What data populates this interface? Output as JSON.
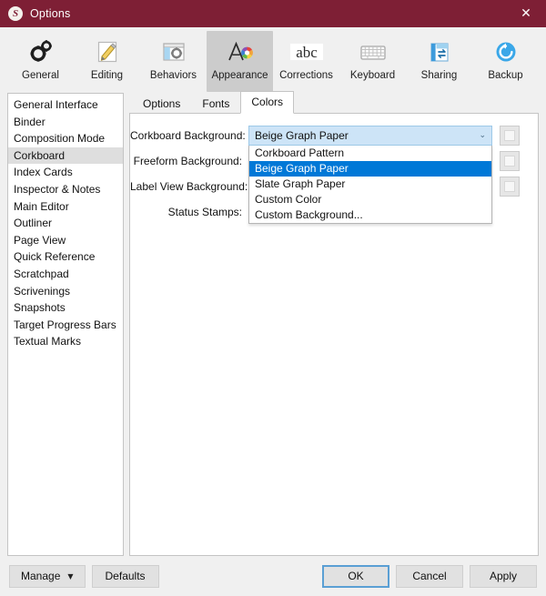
{
  "window": {
    "title": "Options",
    "logo_letter": "S",
    "close_label": "✕"
  },
  "toolbar": {
    "items": [
      {
        "label": "General",
        "icon": "gears-icon",
        "selected": false
      },
      {
        "label": "Editing",
        "icon": "pencil-page-icon",
        "selected": false
      },
      {
        "label": "Behaviors",
        "icon": "window-gear-icon",
        "selected": false
      },
      {
        "label": "Appearance",
        "icon": "a-colorwheel-icon",
        "selected": true
      },
      {
        "label": "Corrections",
        "icon": "abc-icon",
        "selected": false
      },
      {
        "label": "Keyboard",
        "icon": "keyboard-icon",
        "selected": false
      },
      {
        "label": "Sharing",
        "icon": "sharing-icon",
        "selected": false
      },
      {
        "label": "Backup",
        "icon": "backup-circle-icon",
        "selected": false
      }
    ]
  },
  "sidebar": {
    "items": [
      {
        "label": "General Interface",
        "selected": false
      },
      {
        "label": "Binder",
        "selected": false
      },
      {
        "label": "Composition Mode",
        "selected": false
      },
      {
        "label": "Corkboard",
        "selected": true
      },
      {
        "label": "Index Cards",
        "selected": false
      },
      {
        "label": "Inspector & Notes",
        "selected": false
      },
      {
        "label": "Main Editor",
        "selected": false
      },
      {
        "label": "Outliner",
        "selected": false
      },
      {
        "label": "Page View",
        "selected": false
      },
      {
        "label": "Quick Reference",
        "selected": false
      },
      {
        "label": "Scratchpad",
        "selected": false
      },
      {
        "label": "Scrivenings",
        "selected": false
      },
      {
        "label": "Snapshots",
        "selected": false
      },
      {
        "label": "Target Progress Bars",
        "selected": false
      },
      {
        "label": "Textual Marks",
        "selected": false
      }
    ]
  },
  "tabs": [
    {
      "label": "Options",
      "active": false
    },
    {
      "label": "Fonts",
      "active": false
    },
    {
      "label": "Colors",
      "active": true
    }
  ],
  "form": {
    "rows": [
      {
        "label": "Corkboard Background:",
        "control": "combobox"
      },
      {
        "label": "Freeform Background:",
        "control": "swatch"
      },
      {
        "label": "Label View Background:",
        "control": "swatch"
      },
      {
        "label": "Status Stamps:",
        "control": "swatch"
      }
    ]
  },
  "combobox": {
    "value": "Beige Graph Paper",
    "open": true,
    "arrow_glyph": "⌄",
    "options": [
      {
        "label": "Corkboard Pattern",
        "selected": false
      },
      {
        "label": "Beige Graph Paper",
        "selected": true
      },
      {
        "label": "Slate Graph Paper",
        "selected": false
      },
      {
        "label": "Custom Color",
        "selected": false
      },
      {
        "label": "Custom Background...",
        "selected": false
      }
    ]
  },
  "footer": {
    "manage": "Manage",
    "manage_caret": "▼",
    "defaults": "Defaults",
    "ok": "OK",
    "cancel": "Cancel",
    "apply": "Apply"
  },
  "colors": {
    "titlebar": "#7e1f35",
    "selection_blue": "#0078d7",
    "combo_hover": "#cde4f7",
    "sidebar_selected": "#dedede",
    "dialog_bg": "#f0f0f0",
    "toolbar_selected": "#cccccc"
  }
}
